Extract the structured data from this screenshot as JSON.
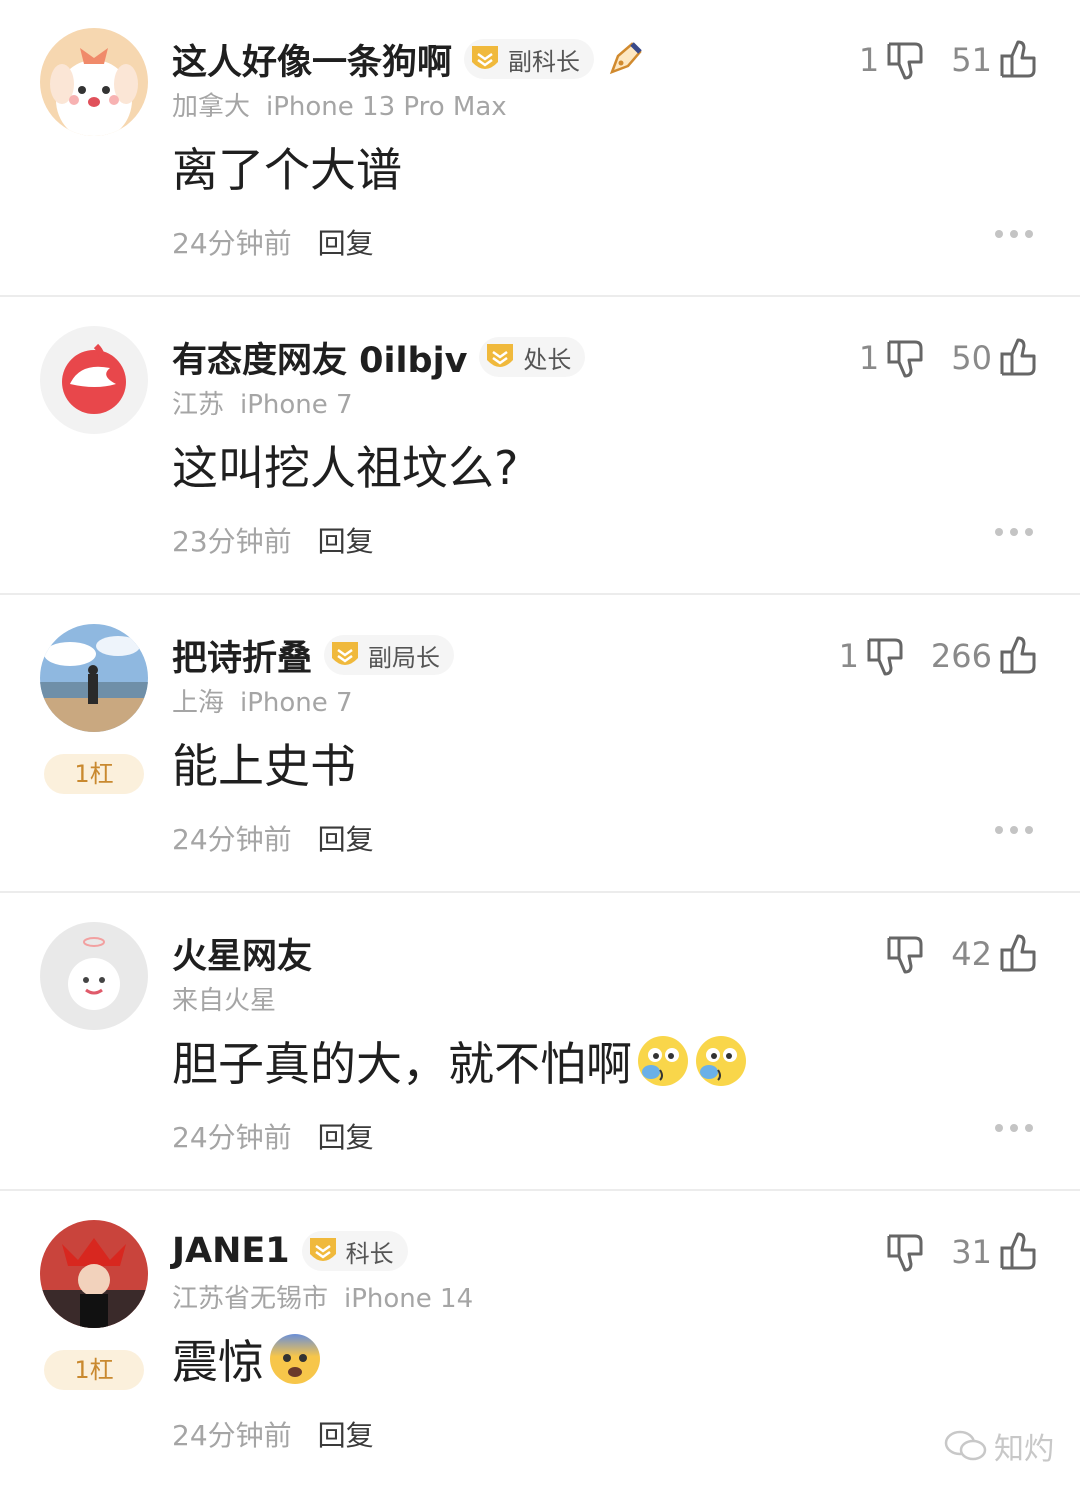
{
  "comments": [
    {
      "username": "这人好像一条狗啊",
      "badge": "副科长",
      "has_pen": true,
      "location": "加拿大",
      "device": "iPhone 13 Pro Max",
      "text": "离了个大谱",
      "time": "24分钟前",
      "reply": "回复",
      "down": "1",
      "up": "51",
      "rank": ""
    },
    {
      "username": "有态度网友 0ilbjv",
      "badge": "处长",
      "has_pen": false,
      "location": "江苏",
      "device": "iPhone 7",
      "text": "这叫挖人祖坟么?",
      "time": "23分钟前",
      "reply": "回复",
      "down": "1",
      "up": "50",
      "rank": ""
    },
    {
      "username": "把诗折叠",
      "badge": "副局长",
      "has_pen": false,
      "location": "上海",
      "device": "iPhone 7",
      "text": "能上史书",
      "time": "24分钟前",
      "reply": "回复",
      "down": "1",
      "up": "266",
      "rank": "1杠"
    },
    {
      "username": "火星网友",
      "badge": "",
      "has_pen": false,
      "location": "来自火星",
      "device": "",
      "text": "胆子真的大，就不怕啊",
      "emoji": "dizzy-crying-emoji",
      "time": "24分钟前",
      "reply": "回复",
      "down": "",
      "up": "42",
      "rank": ""
    },
    {
      "username": "JANE1",
      "badge": "科长",
      "has_pen": false,
      "location": "江苏省无锡市",
      "device": "iPhone 14",
      "text": "震惊",
      "emoji": "fearful-face-emoji",
      "time": "24分钟前",
      "reply": "回复",
      "down": "",
      "up": "31",
      "rank": "1杠"
    }
  ],
  "watermark": "知灼",
  "colors": {
    "badge_gold": "#f0b93c",
    "rank_text": "#c9892f",
    "rank_bg": "#fbf0dc",
    "netease_red": "#e8474b"
  }
}
